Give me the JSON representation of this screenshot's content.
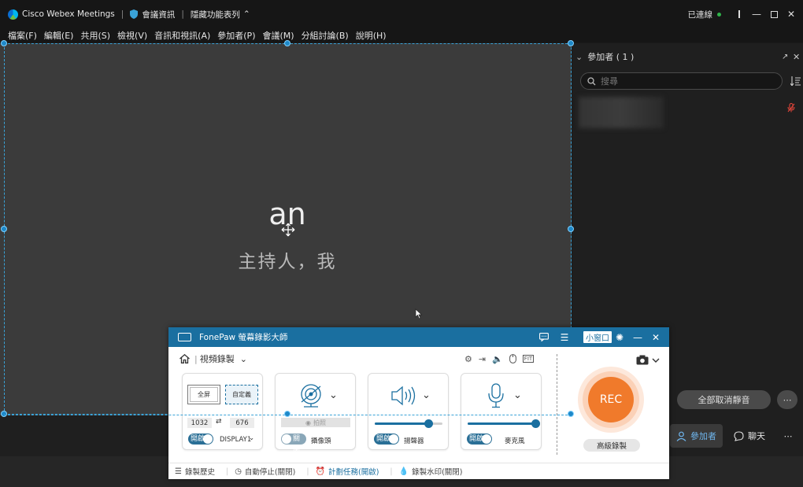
{
  "titlebar": {
    "app_name": "Cisco Webex Meetings",
    "meeting_info": "會議資訊",
    "hide_menu": "隱藏功能表列",
    "connection": "已連線"
  },
  "menu": [
    "檔案(F)",
    "編輯(E)",
    "共用(S)",
    "檢視(V)",
    "音訊和視訊(A)",
    "參加者(P)",
    "會議(M)",
    "分組討論(B)",
    "說明(H)"
  ],
  "stage": {
    "name": "an",
    "role": "主持人，我"
  },
  "panel": {
    "title": "參加者 ( 1 )",
    "search_placeholder": "搜尋",
    "unmute_all": "全部取消靜音",
    "participants_btn": "參加者",
    "chat_btn": "聊天"
  },
  "fonepaw": {
    "title": "FonePaw 螢幕錄影大師",
    "mini_window": "小窗口",
    "mode": "視頻錄製",
    "screen": {
      "full": "全屏",
      "custom": "自定義",
      "width": "1032",
      "height": "676",
      "toggle": "開啟",
      "display": "DISPLAY1"
    },
    "camera": {
      "photo": "拍照",
      "toggle": "關閉",
      "label": "攝像頭"
    },
    "speaker": {
      "toggle": "開啟",
      "label": "揚聲器",
      "volume": 0.8
    },
    "mic": {
      "toggle": "開啟",
      "label": "麥克風",
      "volume": 1.0
    },
    "rec": "REC",
    "advanced": "高級錄製",
    "footer": [
      "錄製歷史",
      "自動停止(關閉)",
      "計劃任務(開啟)",
      "錄製水印(關閉)"
    ]
  },
  "colors": {
    "accent": "#1a6fa0",
    "rec": "#f07a2b",
    "selection": "#3aa3d8"
  }
}
